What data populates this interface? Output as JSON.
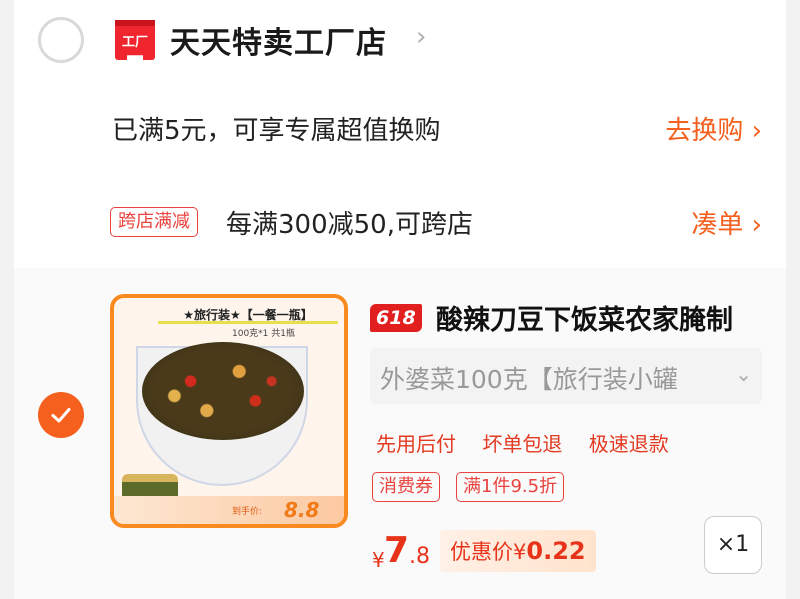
{
  "store": {
    "logo_text": "工厂",
    "name": "天天特卖工厂店",
    "chevron": "›"
  },
  "exchange_promo": {
    "text": "已满5元，可享专属超值换购",
    "link": "去换购 ›"
  },
  "cross_store_promo": {
    "tag": "跨店满减",
    "text": "每满300减50,可跨店",
    "link": "凑单 ›"
  },
  "item": {
    "selected": true,
    "image": {
      "banner": "★旅行装★【一餐一瓶】",
      "sub": "100克*1 共1瓶",
      "hand_price_label": "到手价:",
      "hand_price": "8.8"
    },
    "badge": "618",
    "title": "酸辣刀豆下饭菜农家腌制",
    "sku": "外婆菜100克【旅行装小罐",
    "services": [
      "先用后付",
      "坏单包退",
      "极速退款"
    ],
    "tags": [
      "消费券",
      "满1件9.5折"
    ],
    "price_symbol": "¥",
    "price_integer": "7",
    "price_decimal": ".8",
    "coupon_label": "优惠价¥",
    "coupon_value": "0.22",
    "quantity": "×1"
  },
  "colors": {
    "accent": "#f5601e",
    "red": "#e8331b",
    "store_logo": "#f0252e"
  }
}
